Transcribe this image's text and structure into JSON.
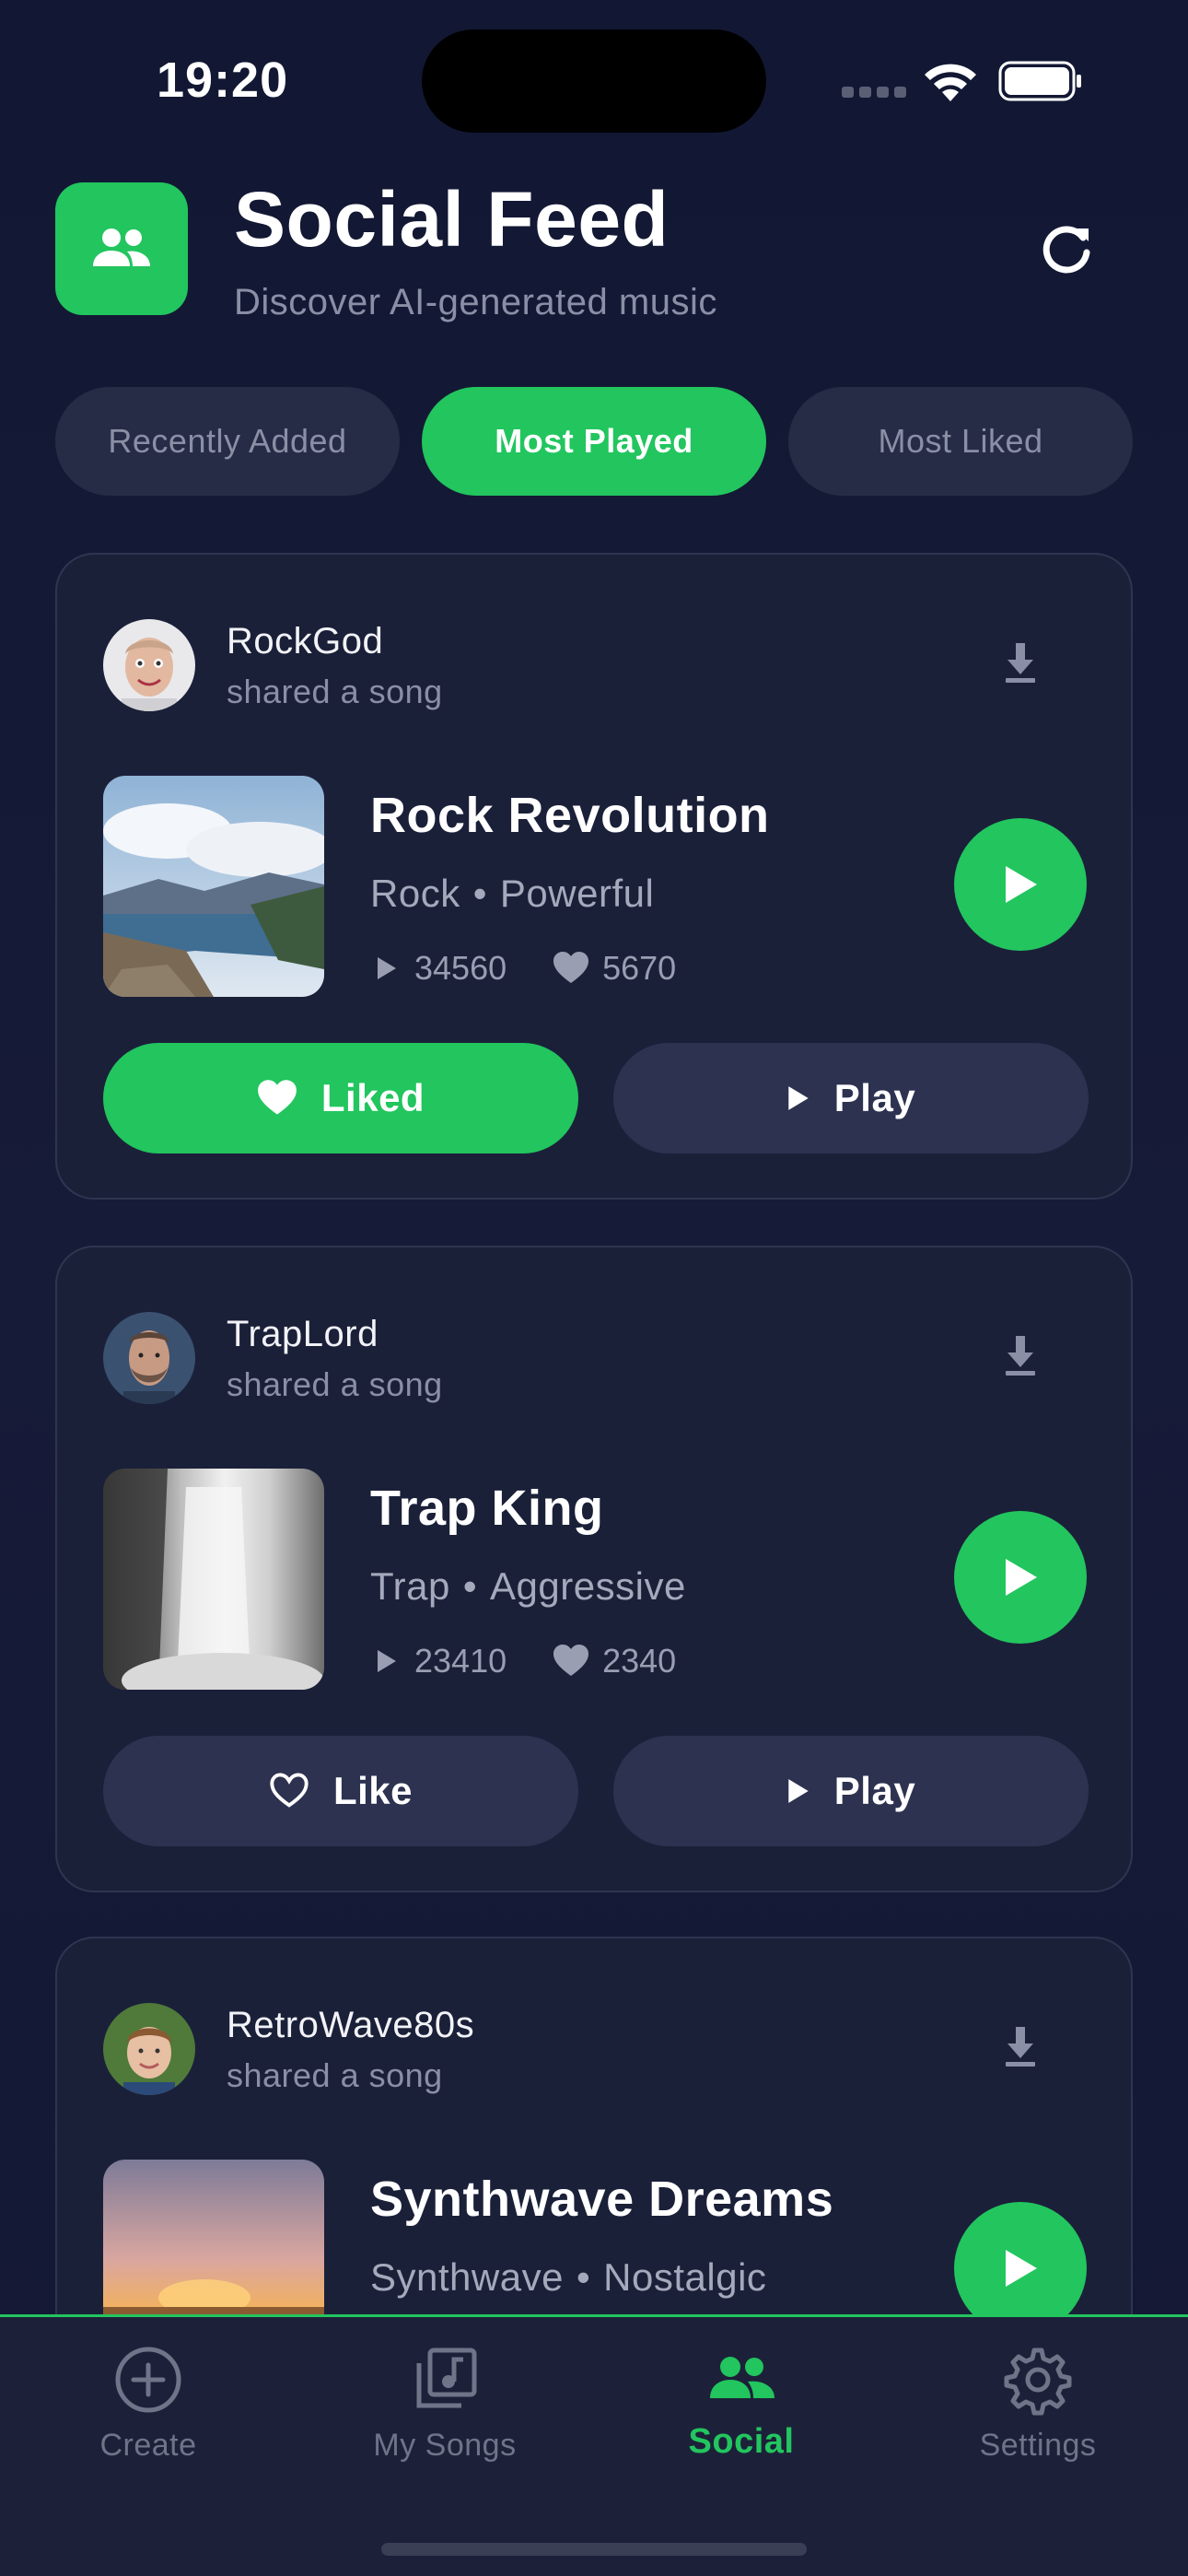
{
  "status_bar": {
    "time": "19:20"
  },
  "header": {
    "title": "Social Feed",
    "subtitle": "Discover AI-generated music",
    "app_icon": "users-icon",
    "refresh_icon": "refresh-icon"
  },
  "tabs": [
    {
      "label": "Recently Added",
      "active": false
    },
    {
      "label": "Most Played",
      "active": true
    },
    {
      "label": "Most Liked",
      "active": false
    }
  ],
  "feed": [
    {
      "username": "RockGod",
      "action": "shared a song",
      "title": "Rock Revolution",
      "genre": "Rock",
      "mood": "Powerful",
      "separator": "•",
      "plays": "34560",
      "likes": "5670",
      "like_label": "Liked",
      "liked": true,
      "play_label": "Play"
    },
    {
      "username": "TrapLord",
      "action": "shared a song",
      "title": "Trap King",
      "genre": "Trap",
      "mood": "Aggressive",
      "separator": "•",
      "plays": "23410",
      "likes": "2340",
      "like_label": "Like",
      "liked": false,
      "play_label": "Play"
    },
    {
      "username": "RetroWave80s",
      "action": "shared a song",
      "title": "Synthwave Dreams",
      "genre": "Synthwave",
      "mood": "Nostalgic",
      "separator": "•"
    }
  ],
  "bottom_nav": [
    {
      "label": "Create",
      "icon": "plus-circle-icon",
      "active": false
    },
    {
      "label": "My Songs",
      "icon": "music-library-icon",
      "active": false
    },
    {
      "label": "Social",
      "icon": "users-icon",
      "active": true
    },
    {
      "label": "Settings",
      "icon": "gear-icon",
      "active": false
    }
  ],
  "colors": {
    "accent": "#22c55e",
    "background": "#141936",
    "card": "#1b2039",
    "muted": "#8a8fa6"
  }
}
